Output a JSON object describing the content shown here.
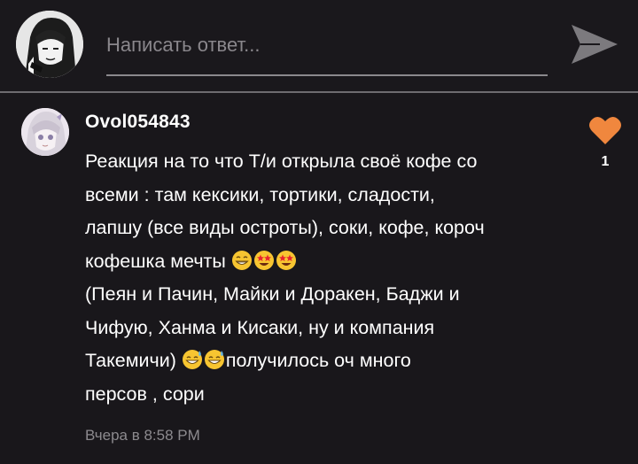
{
  "reply": {
    "placeholder": "Написать ответ..."
  },
  "comment": {
    "username": "Ovol054843",
    "lines": [
      "Реакция на то что Т/и открыла своё кофе со",
      "всеми : там кексики, тортики, сладости,",
      "лапшу (все виды остроты), соки, кофе, короч",
      "кофешка мечты ",
      "(Пеян и Пачин, Майки и Доракен, Баджи и",
      "Чифую, Ханма и Кисаки, ну и компания",
      "Такемичи) ",
      "получилось оч много",
      "персов , сори"
    ],
    "timestamp": "Вчера в 8:58 PM",
    "like_count": "1"
  },
  "colors": {
    "background": "#19171b",
    "like_heart": "#f0873e",
    "muted_text": "#8c8a8e"
  },
  "icons": {
    "send": "send-arrow-icon",
    "like": "heart-icon",
    "emoji_grin": "grinning-emoji-icon",
    "emoji_star_eyes": "star-struck-emoji-icon",
    "emoji_sweat": "sweat-smile-emoji-icon"
  }
}
